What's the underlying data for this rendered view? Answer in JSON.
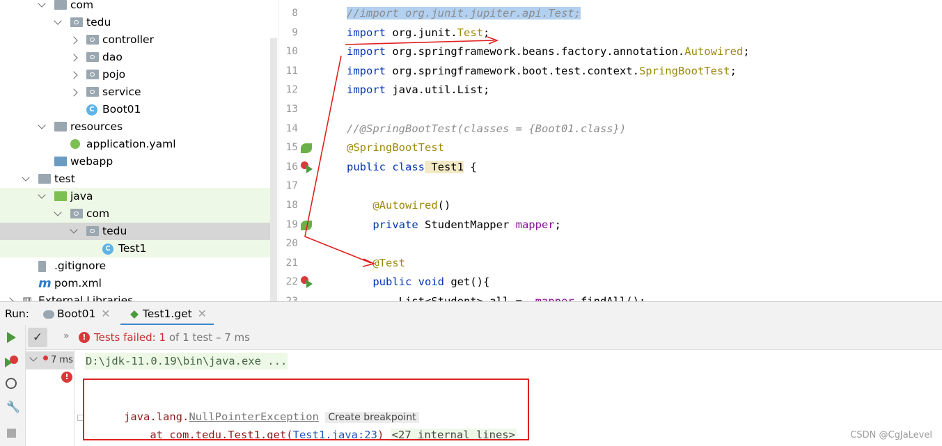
{
  "tree": [
    {
      "label": "com",
      "indent": 1,
      "type": "folder",
      "arrow": "down"
    },
    {
      "label": "tedu",
      "indent": 2,
      "type": "folder",
      "arrow": "down"
    },
    {
      "label": "controller",
      "indent": 3,
      "type": "folder",
      "arrow": "right"
    },
    {
      "label": "dao",
      "indent": 3,
      "type": "folder",
      "arrow": "right"
    },
    {
      "label": "pojo",
      "indent": 3,
      "type": "folder",
      "arrow": "right"
    },
    {
      "label": "service",
      "indent": 3,
      "type": "folder",
      "arrow": "right"
    },
    {
      "label": "Boot01",
      "indent": 3,
      "type": "class",
      "arrow": "none"
    },
    {
      "label": "resources",
      "indent": 1,
      "type": "res",
      "arrow": "down"
    },
    {
      "label": "application.yaml",
      "indent": 2,
      "type": "yaml",
      "arrow": "none"
    },
    {
      "label": "webapp",
      "indent": 1,
      "type": "web",
      "arrow": "none"
    },
    {
      "label": "test",
      "indent": 0,
      "type": "folder",
      "arrow": "down"
    },
    {
      "label": "java",
      "indent": 1,
      "type": "green",
      "arrow": "down"
    },
    {
      "label": "com",
      "indent": 2,
      "type": "folder",
      "arrow": "down"
    },
    {
      "label": "tedu",
      "indent": 3,
      "type": "folder",
      "arrow": "down"
    },
    {
      "label": "Test1",
      "indent": 4,
      "type": "class",
      "arrow": "none"
    },
    {
      "label": ".gitignore",
      "indent": 0,
      "type": "file",
      "arrow": "none"
    },
    {
      "label": "pom.xml",
      "indent": 0,
      "type": "maven",
      "arrow": "none"
    },
    {
      "label": "External Libraries",
      "indent": -1,
      "type": "lib",
      "arrow": "right"
    }
  ],
  "code_lines": [
    {
      "n": "8",
      "seg": [
        [
          "cm sel",
          "//import org.junit.jupiter.api.Test;"
        ]
      ]
    },
    {
      "n": "9",
      "seg": [
        [
          "kw",
          "import"
        ],
        [
          "",
          "org.junit."
        ],
        [
          "an",
          "Test"
        ],
        [
          "",
          ";"
        ]
      ]
    },
    {
      "n": "10",
      "seg": [
        [
          "kw",
          "import"
        ],
        [
          "",
          "org.springframework.beans.factory.annotation."
        ],
        [
          "an",
          "Autowired"
        ],
        [
          "",
          ";"
        ]
      ]
    },
    {
      "n": "11",
      "seg": [
        [
          "kw",
          "import"
        ],
        [
          "",
          "org.springframework.boot.test.context."
        ],
        [
          "an",
          "SpringBootTest"
        ],
        [
          "",
          ";"
        ]
      ]
    },
    {
      "n": "12",
      "seg": [
        [
          "kw",
          "import"
        ],
        [
          "",
          "java.util.List;"
        ]
      ]
    },
    {
      "n": "13",
      "seg": []
    },
    {
      "n": "14",
      "seg": [
        [
          "cm",
          "//@SpringBootTest(classes = {Boot01.class})"
        ]
      ]
    },
    {
      "n": "15",
      "seg": [
        [
          "an",
          "@SpringBootTest"
        ]
      ]
    },
    {
      "n": "16",
      "seg": [
        [
          "kw",
          "public class"
        ],
        [
          "cls-hl",
          "Test1"
        ],
        [
          "",
          " {"
        ]
      ]
    },
    {
      "n": "17",
      "seg": []
    },
    {
      "n": "18",
      "seg": [
        [
          "an",
          "    @Autowired"
        ],
        [
          "",
          "()"
        ]
      ]
    },
    {
      "n": "19",
      "seg": [
        [
          "kw",
          "    private"
        ],
        [
          "",
          "StudentMapper"
        ],
        [
          "fld",
          "mapper"
        ],
        [
          "",
          ";"
        ]
      ]
    },
    {
      "n": "20",
      "seg": []
    },
    {
      "n": "21",
      "seg": [
        [
          "an",
          "    @Test"
        ]
      ]
    },
    {
      "n": "22",
      "seg": [
        [
          "kw",
          "    public void"
        ],
        [
          "",
          "get(){"
        ]
      ]
    },
    {
      "n": "23",
      "seg": [
        [
          "",
          "        List<Student> all = "
        ],
        [
          "fld",
          "mapper"
        ],
        [
          "",
          ".findAll();"
        ]
      ]
    }
  ],
  "run": {
    "label": "Run:",
    "tab1": "Boot01",
    "tab2": "Test1.get"
  },
  "status": {
    "failed": "Tests failed:",
    "count": "1",
    "rest": "of 1 test – 7 ms"
  },
  "test_time": "7 ms",
  "console": {
    "cmd": "D:\\jdk-11.0.19\\bin\\java.exe ...",
    "exc_prefix": "java.lang.",
    "exc_name": "NullPointerException",
    "breakpoint": "Create breakpoint",
    "at_line": "    at com.tedu.Test1.get(",
    "link": "Test1.java:23",
    "close": ")",
    "internal": "<27 internal lines>"
  },
  "watermark": "CSDN @CgJaLevel"
}
